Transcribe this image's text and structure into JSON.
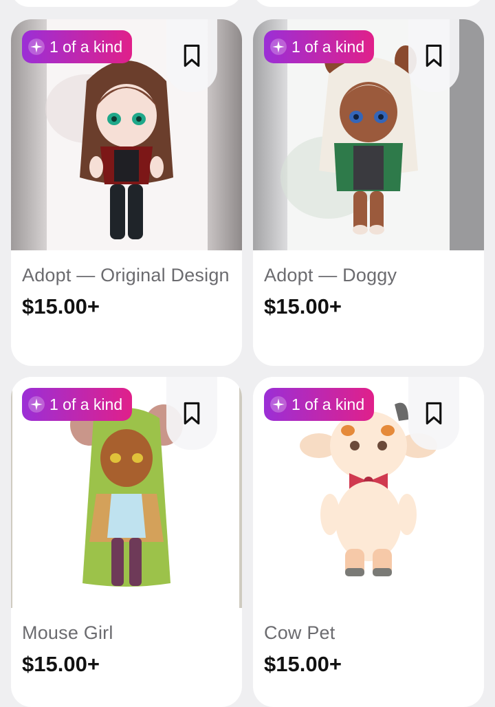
{
  "badge_label": "1 of a kind",
  "colors": {
    "badge_start": "#9b2fd6",
    "badge_end": "#e0208a",
    "price_text": "#111111",
    "title_text": "#6b6b6f"
  },
  "icons": {
    "badge": "sparkle-icon",
    "save": "bookmark-icon"
  },
  "listings": [
    {
      "title": "Adopt — Original Design",
      "price": "$15.00+",
      "badge": "1 of a kind"
    },
    {
      "title": "Adopt — Doggy",
      "price": "$15.00+",
      "badge": "1 of a kind"
    },
    {
      "title": "Mouse Girl",
      "price": "$15.00+",
      "badge": "1 of a kind"
    },
    {
      "title": "Cow Pet",
      "price": "$15.00+",
      "badge": "1 of a kind"
    }
  ]
}
